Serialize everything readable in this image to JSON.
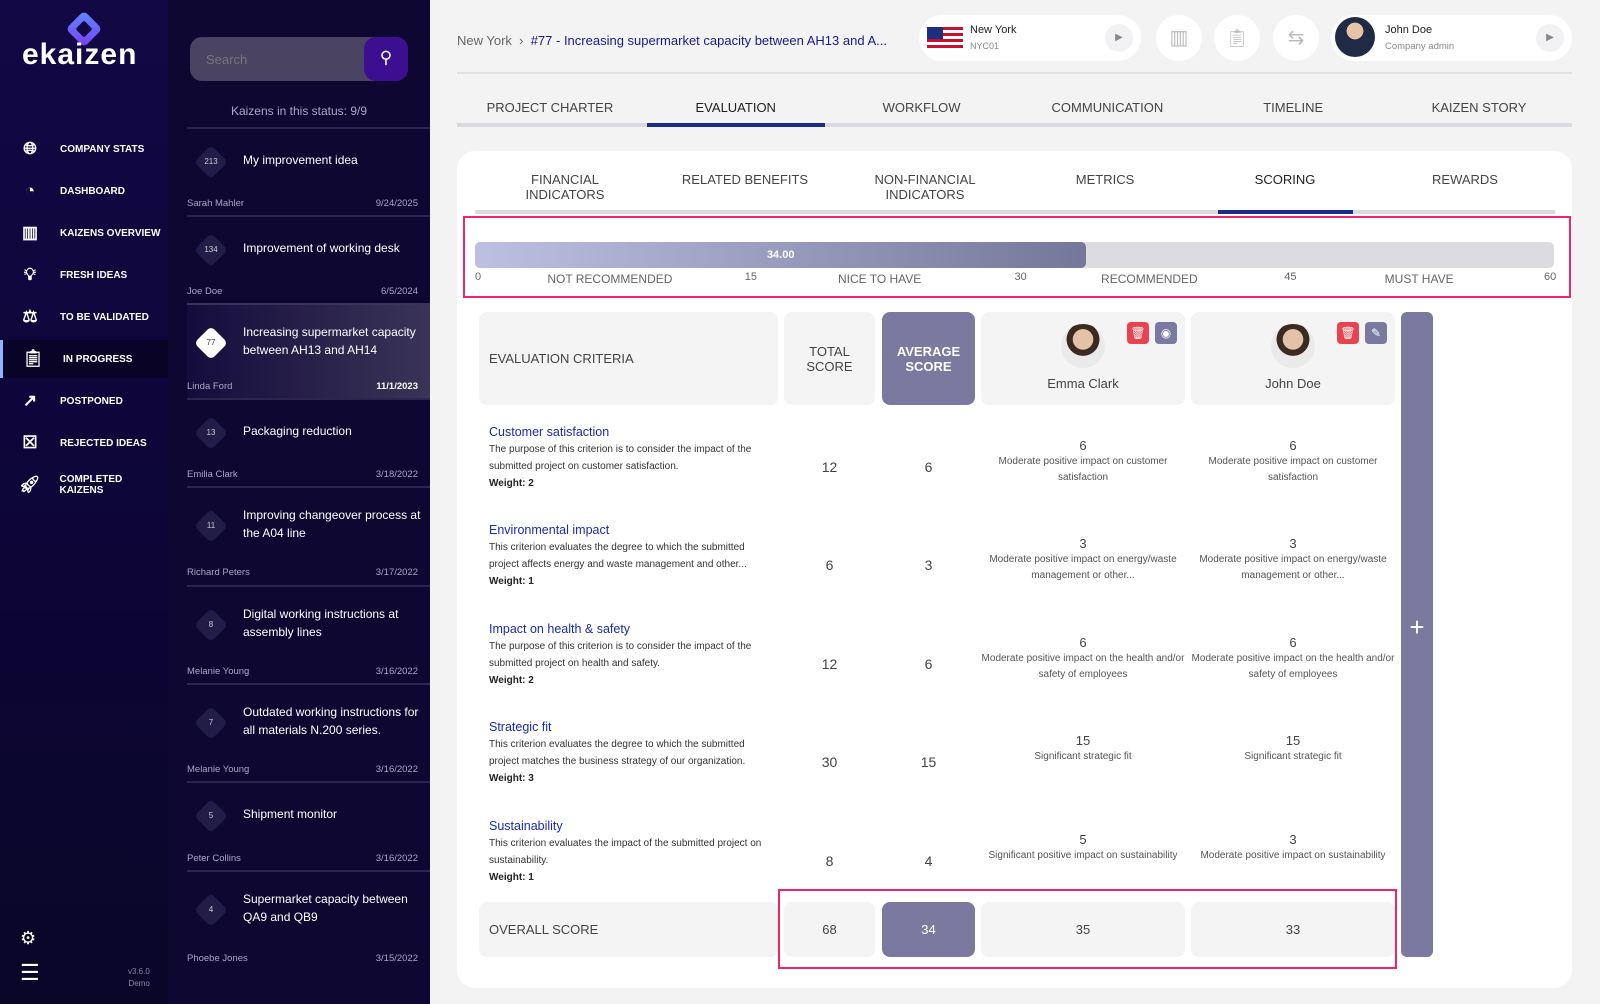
{
  "brand": {
    "name": "ekaizen",
    "version": "v3.6.0",
    "env": "Demo"
  },
  "nav": [
    {
      "label": "COMPANY STATS",
      "icon": "globe-pin-icon"
    },
    {
      "label": "DASHBOARD",
      "icon": "pie-chart-icon"
    },
    {
      "label": "KAIZENS OVERVIEW",
      "icon": "columns-icon"
    },
    {
      "label": "FRESH IDEAS",
      "icon": "lightbulb-icon"
    },
    {
      "label": "TO BE VALIDATED",
      "icon": "scales-icon"
    },
    {
      "label": "IN PROGRESS",
      "icon": "clipboard-icon",
      "active": true
    },
    {
      "label": "POSTPONED",
      "icon": "postpone-icon"
    },
    {
      "label": "REJECTED IDEAS",
      "icon": "clipboard-x-icon"
    },
    {
      "label": "COMPLETED KAIZENS",
      "icon": "rocket-icon"
    }
  ],
  "list": {
    "search_placeholder": "Search",
    "status": "Kaizens in this status: 9/9",
    "items": [
      {
        "id": "213",
        "title": "My improvement idea",
        "author": "Sarah Mahler",
        "date": "9/24/2025"
      },
      {
        "id": "134",
        "title": "Improvement of working desk",
        "author": "Joe Doe",
        "date": "6/5/2024"
      },
      {
        "id": "77",
        "title": "Increasing supermarket capacity between AH13 and AH14",
        "author": "Linda Ford",
        "date": "11/1/2023",
        "selected": true
      },
      {
        "id": "13",
        "title": "Packaging reduction",
        "author": "Emilia Clark",
        "date": "3/18/2022"
      },
      {
        "id": "11",
        "title": "Improving changeover process at the A04 line",
        "author": "Richard Peters",
        "date": "3/17/2022"
      },
      {
        "id": "8",
        "title": "Digital working instructions at assembly lines",
        "author": "Melanie Young",
        "date": "3/16/2022"
      },
      {
        "id": "7",
        "title": "Outdated working instructions for all materials N.200 series.",
        "author": "Melanie Young",
        "date": "3/16/2022"
      },
      {
        "id": "5",
        "title": "Shipment monitor",
        "author": "Peter Collins",
        "date": "3/16/2022"
      },
      {
        "id": "4",
        "title": "Supermarket capacity between QA9 and QB9",
        "author": "Phoebe Jones",
        "date": "3/15/2022"
      }
    ]
  },
  "breadcrumb": {
    "root": "New York",
    "current": "#77 - Increasing supermarket capacity between AH13 and A..."
  },
  "location": {
    "name": "New York",
    "code": "NYC01"
  },
  "user": {
    "name": "John Doe",
    "role": "Company admin"
  },
  "tabs": [
    {
      "label": "PROJECT CHARTER"
    },
    {
      "label": "EVALUATION",
      "active": true
    },
    {
      "label": "WORKFLOW"
    },
    {
      "label": "COMMUNICATION"
    },
    {
      "label": "TIMELINE"
    },
    {
      "label": "KAIZEN STORY"
    }
  ],
  "subtabs": [
    {
      "label": "FINANCIAL INDICATORS"
    },
    {
      "label": "RELATED BENEFITS"
    },
    {
      "label": "NON-FINANCIAL INDICATORS"
    },
    {
      "label": "METRICS"
    },
    {
      "label": "SCORING",
      "active": true
    },
    {
      "label": "REWARDS"
    }
  ],
  "score_bar": {
    "value": 34,
    "value_label": "34.00",
    "max": 60,
    "ticks": [
      "0",
      "15",
      "30",
      "45",
      "60"
    ],
    "zones": [
      "NOT RECOMMENDED",
      "NICE TO HAVE",
      "RECOMMENDED",
      "MUST HAVE"
    ]
  },
  "table": {
    "headers": {
      "criteria": "EVALUATION CRITERIA",
      "total": "TOTAL SCORE",
      "average": "AVERAGE SCORE"
    },
    "evaluators": [
      {
        "name": "Emma Clark",
        "action": "eye-icon"
      },
      {
        "name": "John Doe",
        "action": "pencil-icon"
      }
    ],
    "rows": [
      {
        "name": "Customer satisfaction",
        "desc": "The purpose of this criterion is to consider the impact of the submitted project on customer satisfaction.",
        "weight": "Weight: 2",
        "total": "12",
        "avg": "6",
        "scores": [
          {
            "v": "6",
            "t": "Moderate positive impact on customer satisfaction"
          },
          {
            "v": "6",
            "t": "Moderate positive impact on customer satisfaction"
          }
        ]
      },
      {
        "name": "Environmental impact",
        "desc": "This criterion evaluates the degree to which the submitted project affects energy and waste management and other...",
        "weight": "Weight: 1",
        "total": "6",
        "avg": "3",
        "scores": [
          {
            "v": "3",
            "t": "Moderate positive impact on energy/waste management or other..."
          },
          {
            "v": "3",
            "t": "Moderate positive impact on energy/waste management or other..."
          }
        ]
      },
      {
        "name": "Impact on health & safety",
        "desc": "The purpose of this criterion is to consider the impact of the submitted project on health and safety.",
        "weight": "Weight: 2",
        "total": "12",
        "avg": "6",
        "scores": [
          {
            "v": "6",
            "t": "Moderate positive impact on the health and/or safety of employees"
          },
          {
            "v": "6",
            "t": "Moderate positive impact on the health and/or safety of employees"
          }
        ]
      },
      {
        "name": "Strategic fit",
        "desc": "This criterion evaluates the degree to which the submitted project matches the business strategy of our organization.",
        "weight": "Weight: 3",
        "total": "30",
        "avg": "15",
        "scores": [
          {
            "v": "15",
            "t": "Significant strategic fit"
          },
          {
            "v": "15",
            "t": "Significant strategic fit"
          }
        ]
      },
      {
        "name": "Sustainability",
        "desc": "This criterion evaluates the impact of the submitted project on sustainability.",
        "weight": "Weight: 1",
        "total": "8",
        "avg": "4",
        "scores": [
          {
            "v": "5",
            "t": "Significant positive impact on sustainability"
          },
          {
            "v": "3",
            "t": "Moderate positive impact on sustainability"
          }
        ]
      }
    ],
    "overall": {
      "label": "OVERALL SCORE",
      "total": "68",
      "avg": "34",
      "scores": [
        "35",
        "33"
      ]
    }
  },
  "colors": {
    "accent": "#7a7aa0",
    "link": "#1a2bb0",
    "highlight": "#f0246e",
    "delete": "#e8434f"
  }
}
